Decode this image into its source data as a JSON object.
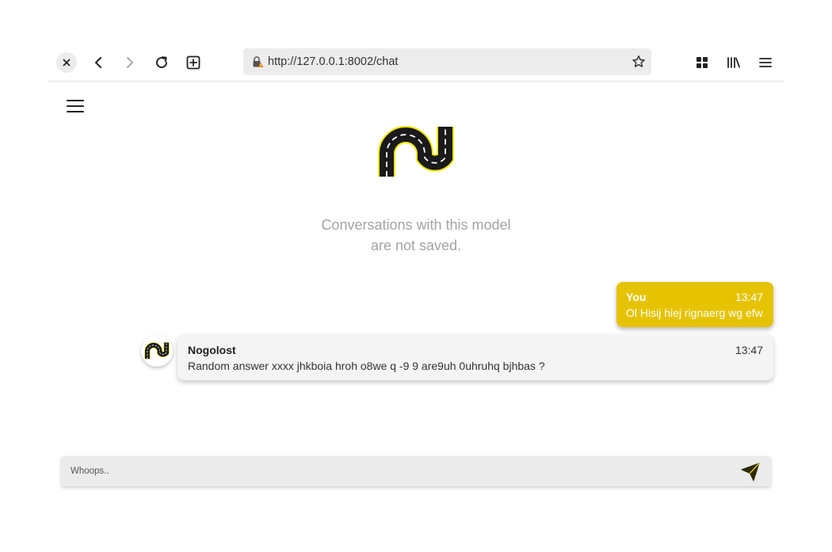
{
  "browser": {
    "url": "http://127.0.0.1:8002/chat",
    "icons": [
      "close-icon",
      "back-icon",
      "forward-icon",
      "reload-icon",
      "new-tab-icon",
      "lock-warning-icon",
      "bookmark-star-icon",
      "extensions-grid-icon",
      "library-icon",
      "menu-icon"
    ]
  },
  "app": {
    "notice_line1": "Conversations with this model",
    "notice_line2": "are not saved."
  },
  "messages": [
    {
      "sender": "You",
      "time": "13:47",
      "text": "Ol Hisij hiej rignaerg wg efw"
    },
    {
      "sender": "Nogolost",
      "time": "13:47",
      "text": "Random answer xxxx jhkboia hroh o8we q -9 9 are9uh 0uhruhq bjhbas ?"
    }
  ],
  "composer": {
    "value": "",
    "placeholder": "Whoops.."
  },
  "colors": {
    "accent": "#e6c300",
    "road_yellow": "#f2e600",
    "road_dark": "#1a1a1a"
  }
}
